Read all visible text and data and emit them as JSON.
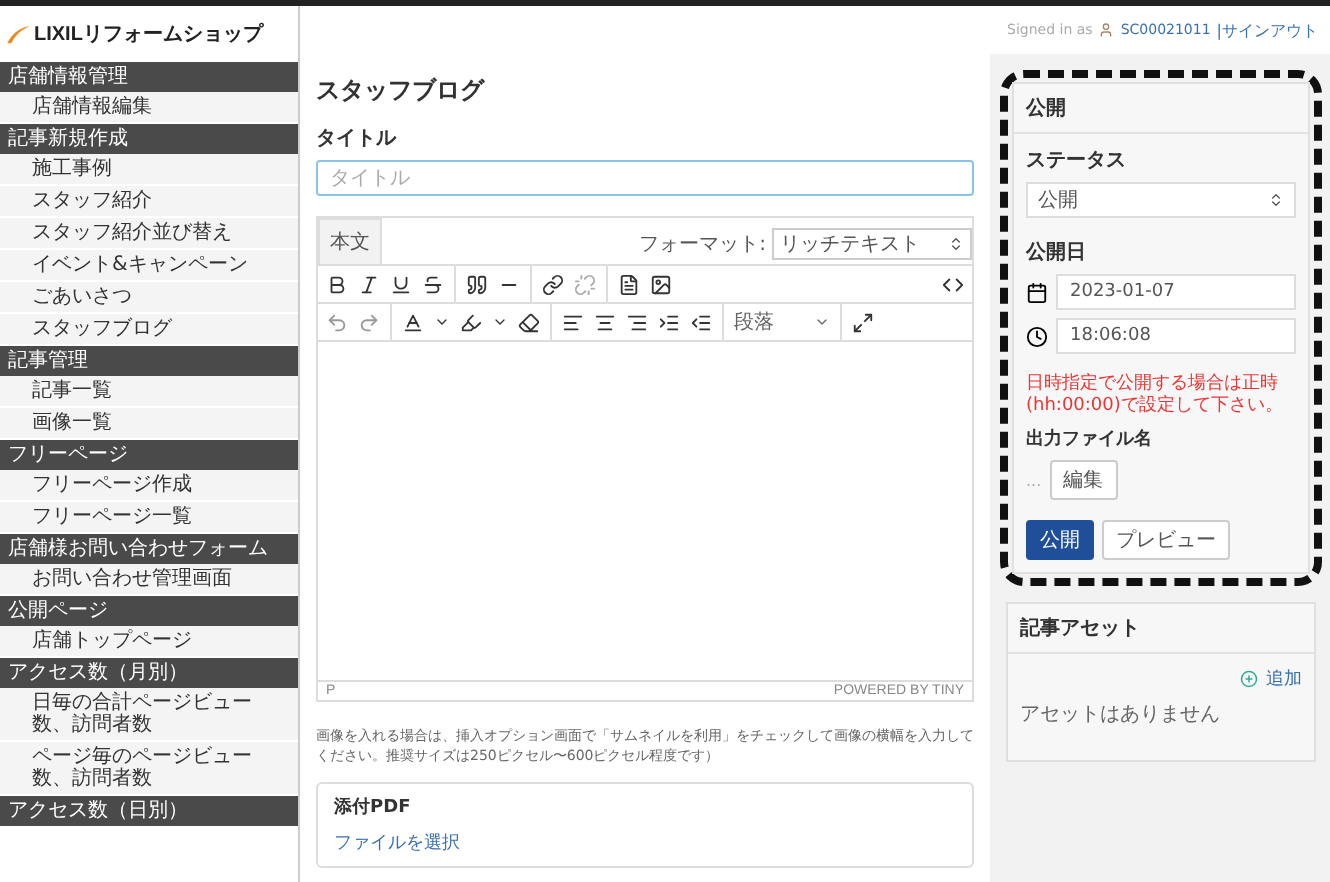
{
  "header": {
    "logo": "LIXILリフォームショップ",
    "signed_in_label": "Signed in as",
    "user": "SC00021011",
    "signout": "|サインアウト"
  },
  "sidebar": [
    {
      "heading": "店舗情報管理",
      "items": [
        {
          "label": "店舗情報編集",
          "selected": false
        }
      ]
    },
    {
      "heading": "記事新規作成",
      "items": [
        {
          "label": "施工事例",
          "selected": false
        },
        {
          "label": "スタッフ紹介",
          "selected": false
        },
        {
          "label": "スタッフ紹介並び替え",
          "selected": false
        },
        {
          "label": "イベント&キャンペーン",
          "selected": false
        },
        {
          "label": "ごあいさつ",
          "selected": false
        },
        {
          "label": "スタッフブログ",
          "selected": false
        }
      ]
    },
    {
      "heading": "記事管理",
      "items": [
        {
          "label": "記事一覧",
          "selected": false
        },
        {
          "label": "画像一覧",
          "selected": false
        }
      ]
    },
    {
      "heading": "フリーページ",
      "items": [
        {
          "label": "フリーページ作成",
          "selected": false
        },
        {
          "label": "フリーページ一覧",
          "selected": false
        }
      ]
    },
    {
      "heading": "店舗様お問い合わせフォーム",
      "items": [
        {
          "label": "お問い合わせ管理画面",
          "selected": false
        }
      ]
    },
    {
      "heading": "公開ページ",
      "items": [
        {
          "label": "店舗トップページ",
          "selected": false
        }
      ]
    },
    {
      "heading": "アクセス数（月別）",
      "items": [
        {
          "label": "日毎の合計ページビュー数、訪問者数",
          "selected": false
        },
        {
          "label": "ページ毎のページビュー数、訪問者数",
          "selected": false
        }
      ]
    },
    {
      "heading": "アクセス数（日別）"
    }
  ],
  "page_title": "スタッフブログ",
  "title_field": {
    "label": "タイトル",
    "placeholder": "タイトル"
  },
  "editor": {
    "tab": "本文",
    "format_label": "フォーマット:",
    "format_value": "リッチテキスト",
    "paragraph_select": "段落",
    "status_path": "P",
    "powered_by": "POWERED BY TINY"
  },
  "note": "画像を入れる場合は、挿入オプション画面で「サムネイルを利用」をチェックして画像の横幅を入力してください。推奨サイズは250ピクセル〜600ピクセル程度です）",
  "pdf": {
    "label": "添付PDF",
    "link": "ファイルを選択"
  },
  "publish_panel": {
    "title": "公開",
    "status_label": "ステータス",
    "status_value": "公開",
    "date_label": "公開日",
    "date": "2023-01-07",
    "time": "18:06:08",
    "warning": "日時指定で公開する場合は正時(hh:00:00)で設定して下さい。",
    "filename_label": "出力ファイル名",
    "filename_prefix": "...",
    "edit_button": "編集",
    "publish_button": "公開",
    "preview_button": "プレビュー"
  },
  "assets_panel": {
    "title": "記事アセット",
    "add_link": "追加",
    "empty": "アセットはありません"
  }
}
